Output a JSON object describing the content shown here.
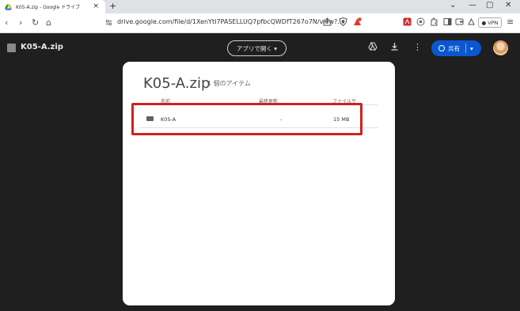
{
  "browser": {
    "tab_title": "K05-A.zip - Google ドライブ",
    "tab_close": "×",
    "new_tab": "+",
    "window_controls": [
      "⌄",
      "—",
      "▢",
      "✕"
    ],
    "url": "drive.google.com/file/d/1XenYtI7PASELLUQ7pfbcQWDfT267o7N/view?...",
    "nav": [
      "‹",
      "›",
      "↻",
      "⌂"
    ],
    "vpn_label": "● VPN",
    "menu_icon": "≡"
  },
  "drive_header": {
    "file_title": "K05-A.zip",
    "open_with_label": "アプリで開く ▾",
    "share_label": "共有",
    "share_dropdown": "▾",
    "more_icon": "⋮",
    "download_icon": "⤓",
    "add_drive_icon": "⧉"
  },
  "content": {
    "zip_title": "K05-A.zip",
    "item_count": "1 個のアイテム",
    "columns": [
      "名前",
      "最終更新",
      "ファイルサ"
    ],
    "rows": [
      {
        "name": "K05-A",
        "modified": "-",
        "size": "15 MB"
      }
    ]
  },
  "colors": {
    "share_button": "#0b57d0",
    "highlight_border": "#d32020",
    "page_bg": "#1f1f1f"
  }
}
